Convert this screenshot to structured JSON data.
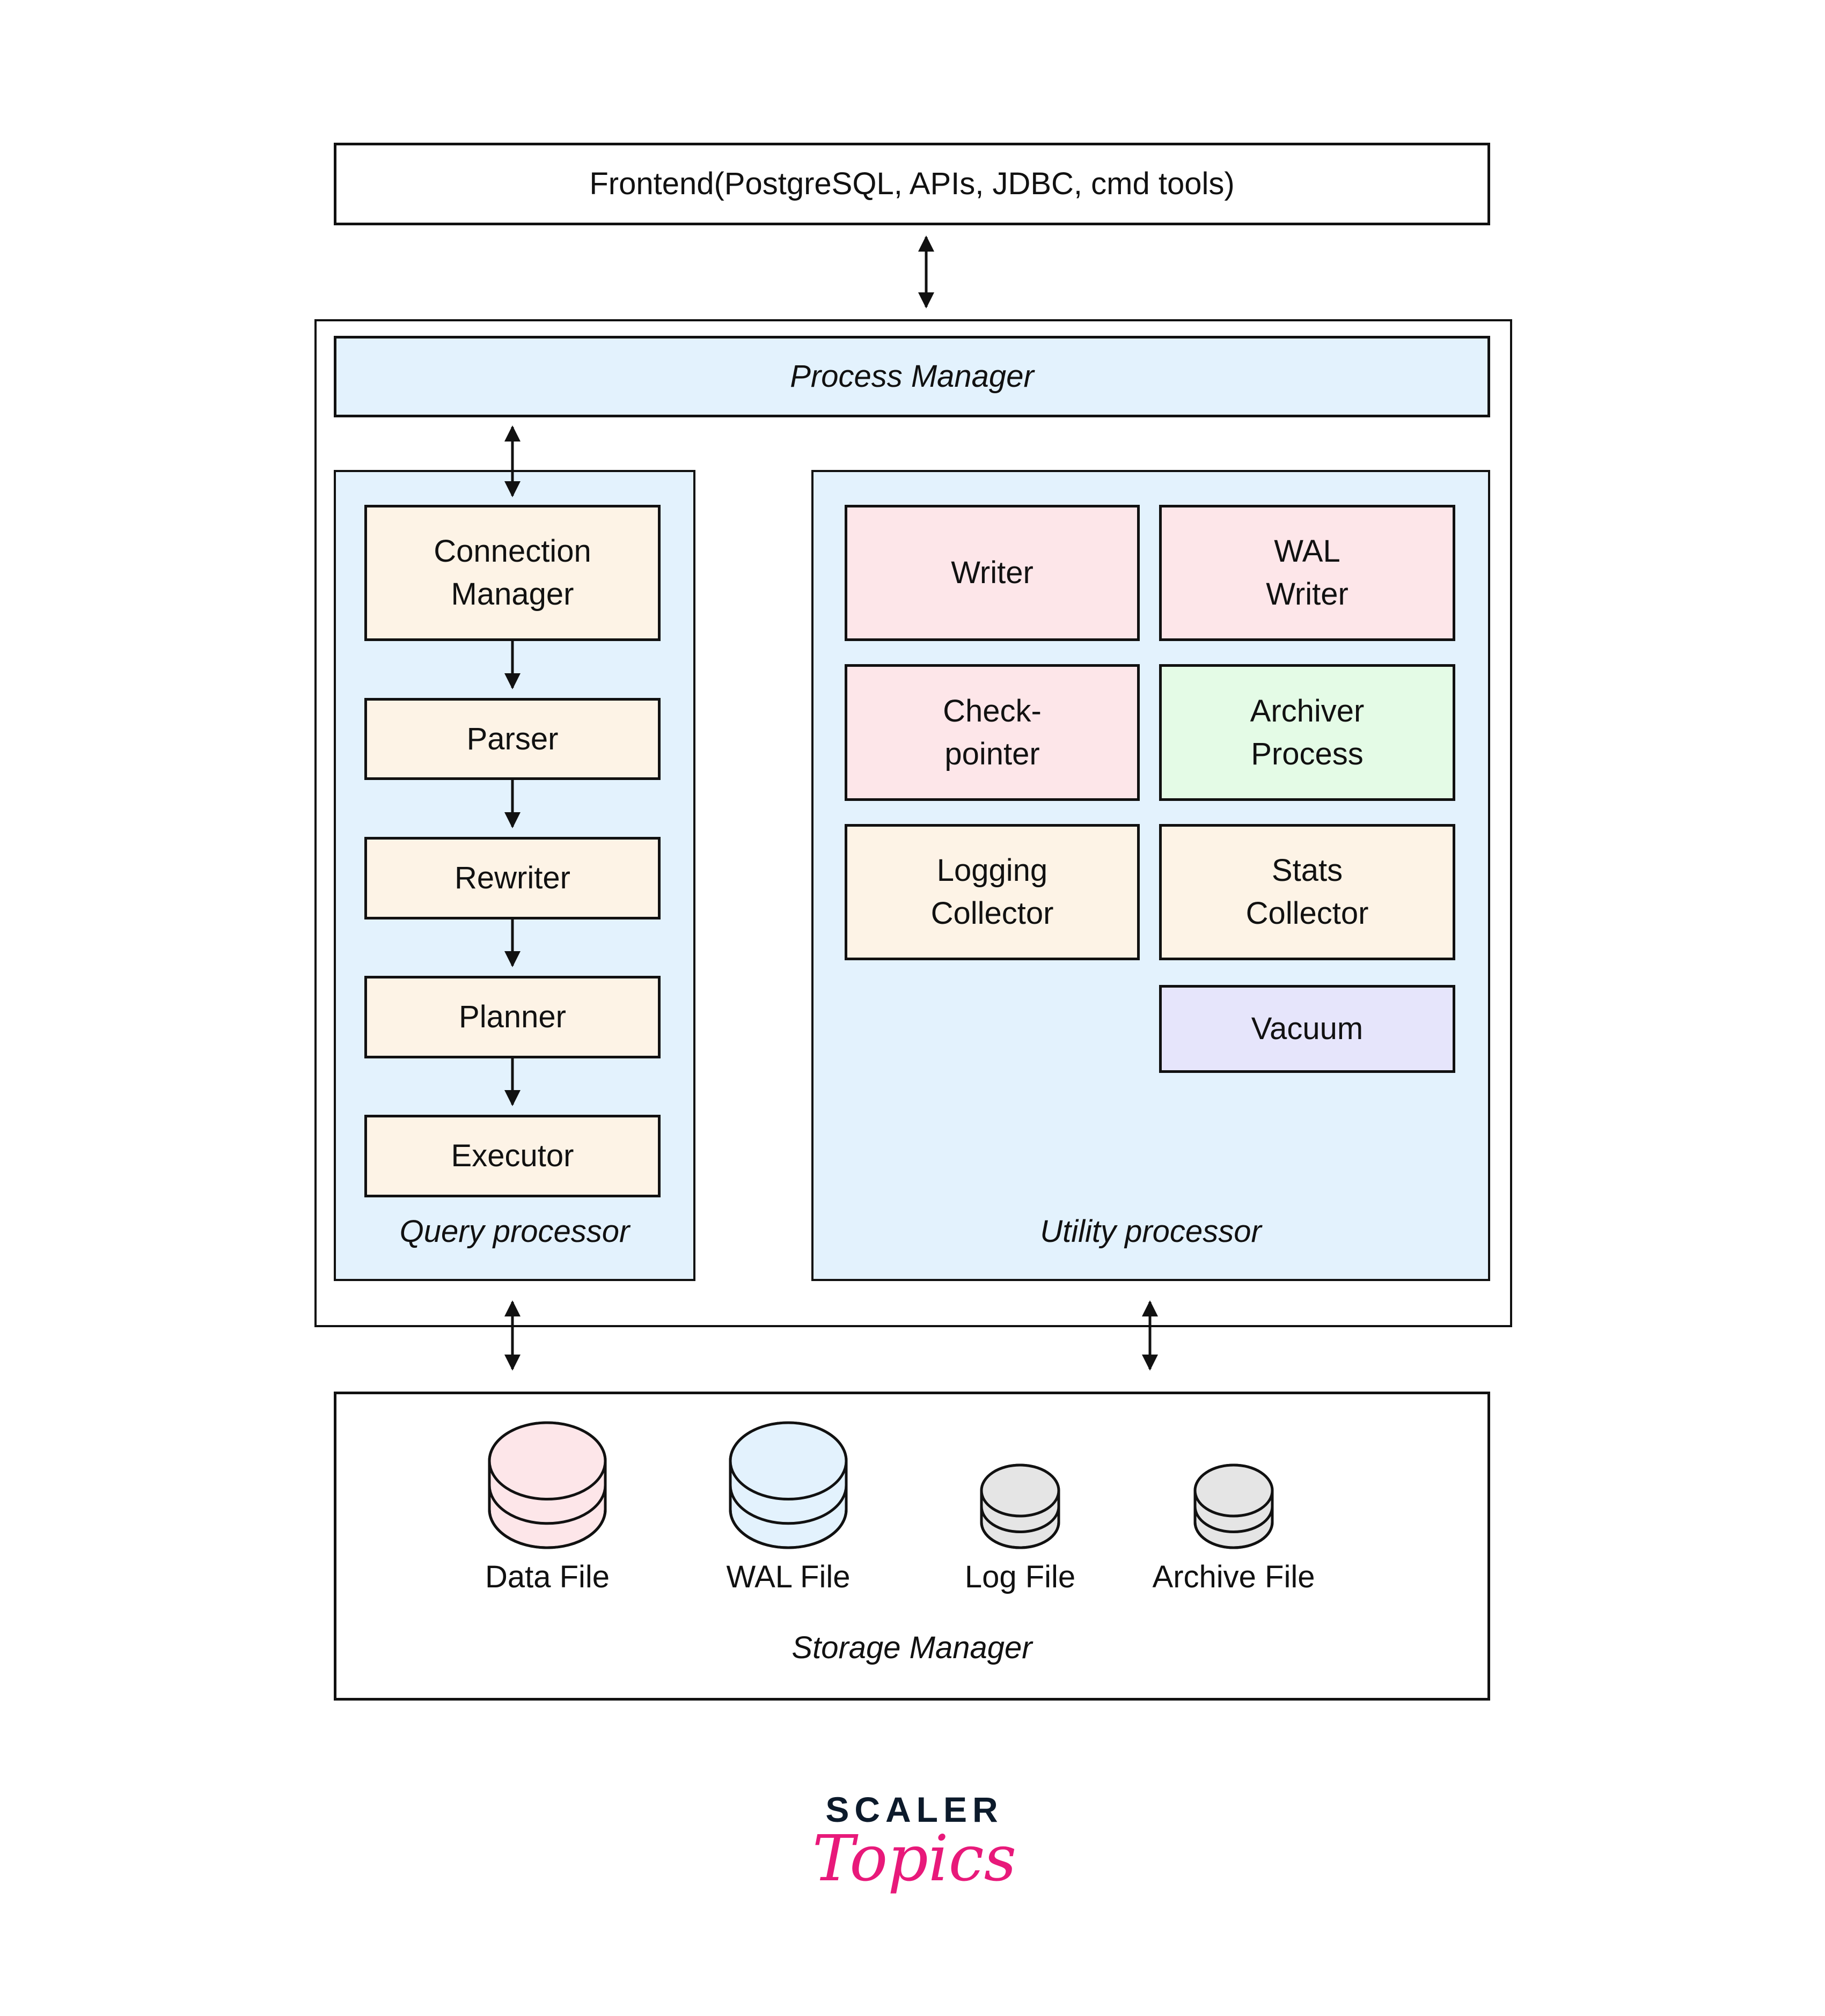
{
  "frontend": {
    "label": "Frontend(PostgreSQL, APIs, JDBC, cmd tools)"
  },
  "process_manager": {
    "label": "Process Manager"
  },
  "query_processor": {
    "caption": "Query processor",
    "steps": [
      {
        "label": "Connection\nManager"
      },
      {
        "label": "Parser"
      },
      {
        "label": "Rewriter"
      },
      {
        "label": "Planner"
      },
      {
        "label": "Executor"
      }
    ]
  },
  "utility_processor": {
    "caption": "Utility processor",
    "items": [
      {
        "label": "Writer",
        "color": "#fde6e9"
      },
      {
        "label": "WAL\nWriter",
        "color": "#fde6e9"
      },
      {
        "label": "Check-\npointer",
        "color": "#fde6e9"
      },
      {
        "label": "Archiver\nProcess",
        "color": "#e4fbe6"
      },
      {
        "label": "Logging\nCollector",
        "color": "#fdf3e6"
      },
      {
        "label": "Stats\nCollector",
        "color": "#fdf3e6"
      },
      {
        "label": "Vacuum",
        "color": "#e6e5fb"
      }
    ]
  },
  "storage_manager": {
    "caption": "Storage Manager",
    "files": [
      {
        "label": "Data File",
        "color": "#fde6e9"
      },
      {
        "label": "WAL File",
        "color": "#e3f2fd"
      },
      {
        "label": "Log File",
        "color": "#e5e5e5"
      },
      {
        "label": "Archive File",
        "color": "#e5e5e5"
      }
    ]
  },
  "colors": {
    "container_blue": "#e3f2fd",
    "step_cream": "#fdf3e6",
    "logo_navy": "#0c1a2b",
    "logo_pink": "#e8197a"
  },
  "logo": {
    "line1": "SCALER",
    "line2": "Topics"
  }
}
